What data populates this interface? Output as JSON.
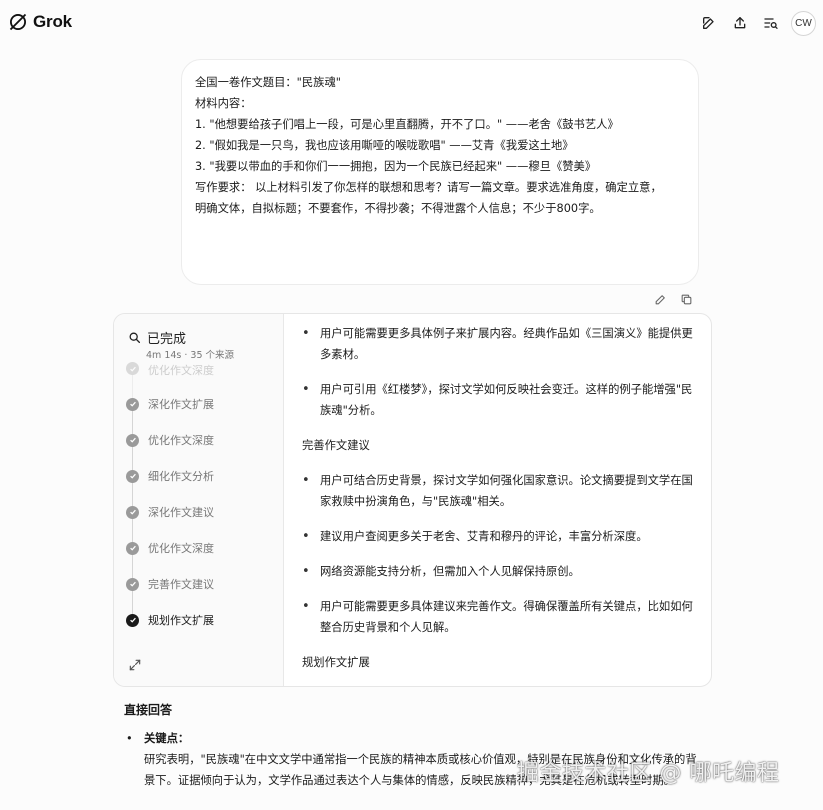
{
  "header": {
    "app_name": "Grok",
    "avatar_initials": "CW"
  },
  "user_message": {
    "lines": [
      "全国一卷作文题目：\"民族魂\"",
      "",
      "材料内容：",
      "",
      "1. \"他想要给孩子们唱上一段，可是心里直翻腾，开不了口。\" ——老舍《鼓书艺人》",
      "2. \"假如我是一只鸟，我也应该用嘶哑的喉咙歌唱\" ——艾青《我爱这土地》",
      "3. \"我要以带血的手和你们一一拥抱，因为一个民族已经起来\" ——穆旦《赞美》",
      "",
      "写作要求： 以上材料引发了你怎样的联想和思考？请写一篇文章。要求选准角度，确定立意，",
      "明确文体，自拟标题；不要套作，不得抄袭；不得泄露个人信息；不少于800字。"
    ]
  },
  "thinking": {
    "status": "已完成",
    "meta": "4m 14s · 35 个来源",
    "steps": [
      {
        "label": "优化作文深度",
        "state": "faded"
      },
      {
        "label": "深化作文扩展",
        "state": "done"
      },
      {
        "label": "优化作文深度",
        "state": "done"
      },
      {
        "label": "细化作文分析",
        "state": "done"
      },
      {
        "label": "深化作文建议",
        "state": "done"
      },
      {
        "label": "优化作文深度",
        "state": "done"
      },
      {
        "label": "完善作文建议",
        "state": "done"
      },
      {
        "label": "规划作文扩展",
        "state": "active"
      }
    ],
    "content": {
      "bullets_a": [
        "用户可能需要更多具体例子来扩展内容。经典作品如《三国演义》能提供更多素材。",
        "用户可引用《红楼梦》，探讨文学如何反映社会变迁。这样的例子能增强\"民族魂\"分析。"
      ],
      "heading_b": "完善作文建议",
      "bullets_b": [
        "用户可结合历史背景，探讨文学如何强化国家意识。论文摘要提到文学在国家救赎中扮演角色，与\"民族魂\"相关。",
        "建议用户查阅更多关于老舍、艾青和穆丹的评论，丰富分析深度。",
        "网络资源能支持分析，但需加入个人见解保持原创。",
        "用户可能需要更多具体建议来完善作文。得确保覆盖所有关键点，比如如何整合历史背景和个人见解。"
      ],
      "heading_c": "规划作文扩展"
    }
  },
  "answer": {
    "heading": "直接回答",
    "key_label": "关键点：",
    "text": "研究表明，\"民族魂\"在中文文学中通常指一个民族的精神本质或核心价值观，特别是在民族身份和文化传承的背景下。证据倾向于认为，文学作品通过表达个人与集体的情感，反映民族精神，尤其是在危机或转型时期。"
  },
  "watermark": "掘金技术社区 @ 哪吒编程"
}
